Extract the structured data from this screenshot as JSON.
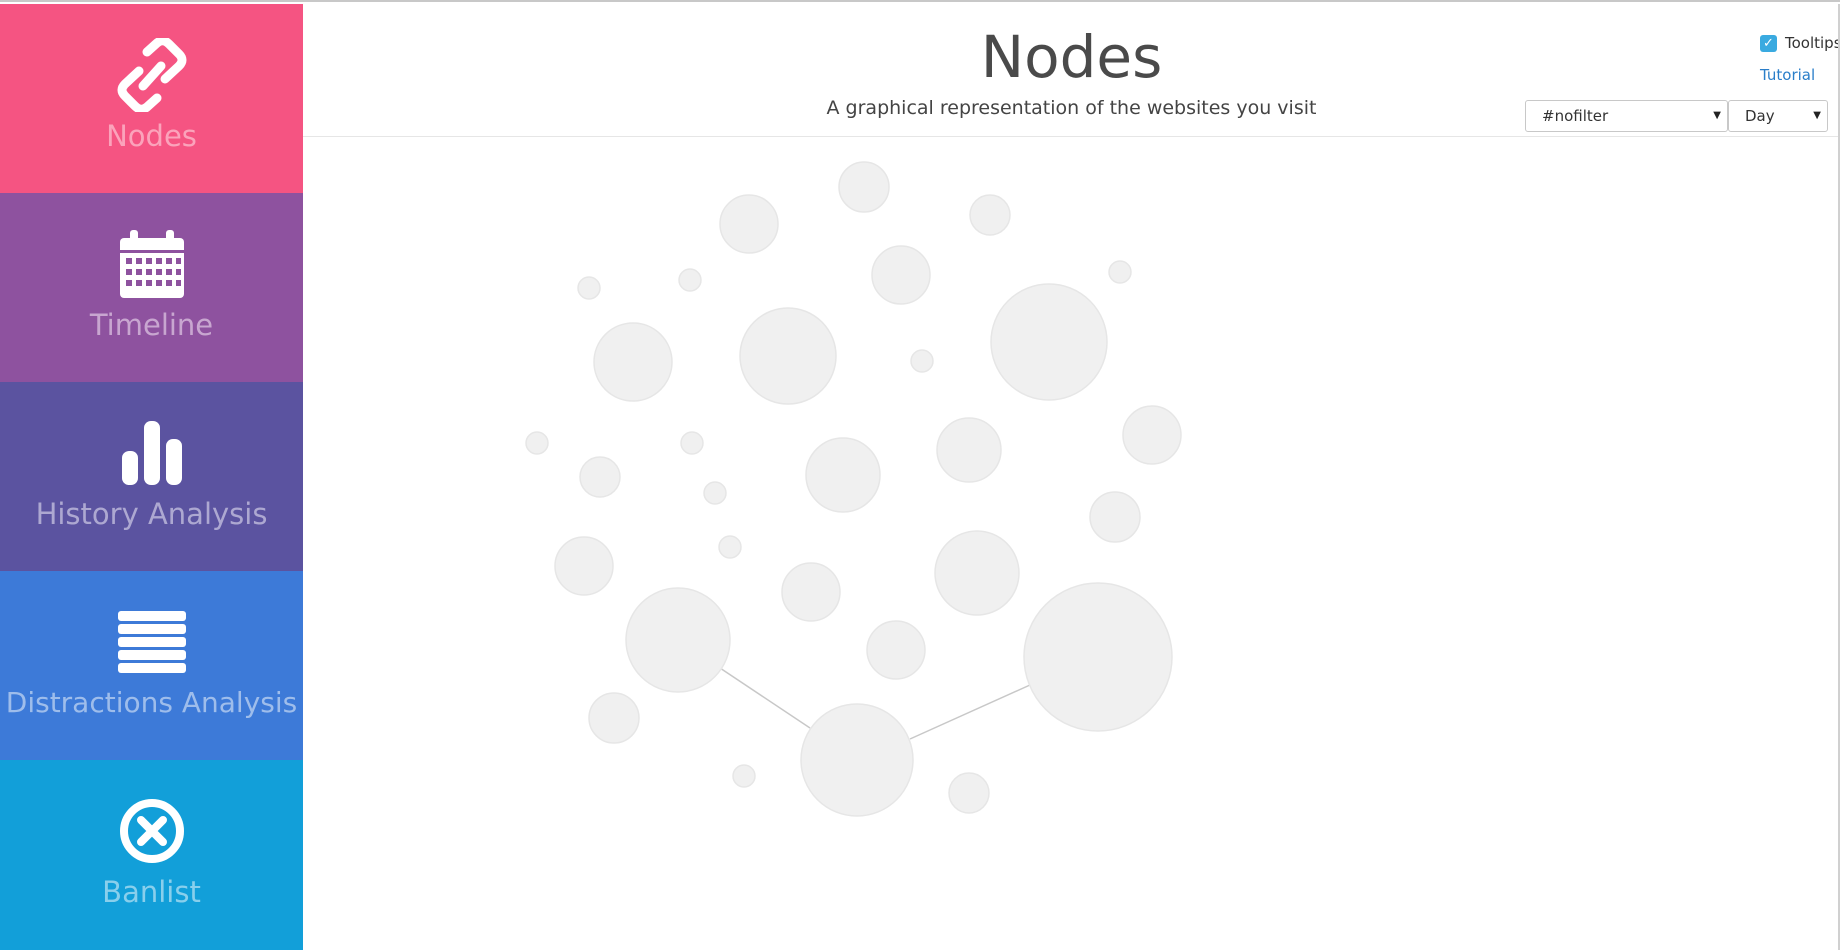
{
  "sidebar": {
    "items": [
      {
        "label": "Nodes",
        "icon": "link-icon",
        "color": "#f55482"
      },
      {
        "label": "Timeline",
        "icon": "calendar-icon",
        "color": "#8e529f"
      },
      {
        "label": "History Analysis",
        "icon": "bar-chart-icon",
        "color": "#5b53a0"
      },
      {
        "label": "Distractions Analysis",
        "icon": "list-icon",
        "color": "#3d7ad8"
      },
      {
        "label": "Banlist",
        "icon": "close-circle-icon",
        "color": "#129fd9"
      }
    ]
  },
  "header": {
    "title": "Nodes",
    "subtitle": "A graphical representation of the websites you visit"
  },
  "controls": {
    "tooltips_label": "Tooltips",
    "tooltips_checked": true,
    "tutorial_label": "Tutorial",
    "filter_value": "#nofilter",
    "period_value": "Day"
  },
  "graph": {
    "node_color": "#f0f0f0",
    "node_count": 37,
    "link_count": 2
  }
}
